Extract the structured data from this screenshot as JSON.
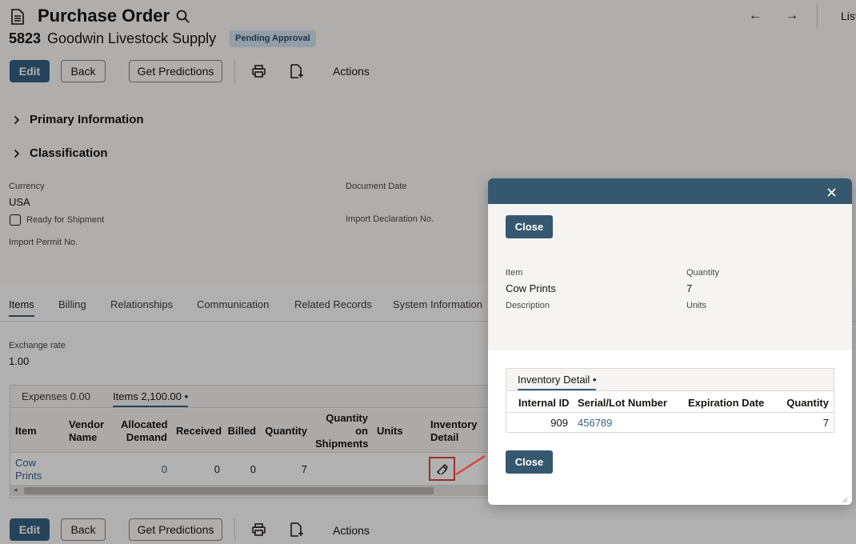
{
  "header": {
    "title": "Purchase Order",
    "record_number": "5823",
    "vendor": "Goodwin Livestock Supply",
    "status": "Pending Approval",
    "list_label": "List"
  },
  "toolbar": {
    "edit": "Edit",
    "back": "Back",
    "get_predictions": "Get Predictions",
    "actions": "Actions"
  },
  "sections": {
    "primary": "Primary Information",
    "classification": "Classification"
  },
  "fields": {
    "currency_label": "Currency",
    "currency_value": "USA",
    "ready_for_shipment": "Ready for Shipment",
    "import_permit_label": "Import Permit No.",
    "document_date_label": "Document Date",
    "import_declaration_label": "Import Declaration No."
  },
  "tabs": [
    "Items",
    "Billing",
    "Relationships",
    "Communication",
    "Related Records",
    "System Information"
  ],
  "exchange": {
    "label": "Exchange rate",
    "value": "1.00"
  },
  "subtabs": {
    "expenses": "Expenses 0.00",
    "items": "Items 2,100.00 •"
  },
  "items_table": {
    "headers": {
      "item": "Item",
      "vendor_name": "Vendor Name",
      "allocated_demand": "Allocated Demand",
      "received": "Received",
      "billed": "Billed",
      "quantity": "Quantity",
      "quantity_on_shipments": "Quantity on Shipments",
      "units": "Units",
      "inventory_detail": "Inventory Detail"
    },
    "row": {
      "item": "Cow Prints",
      "allocated_demand": "0",
      "received": "0",
      "billed": "0",
      "quantity": "7"
    }
  },
  "modal": {
    "close_label": "Close",
    "item_label": "Item",
    "item_value": "Cow Prints",
    "description_label": "Description",
    "quantity_label": "Quantity",
    "quantity_value": "7",
    "units_label": "Units",
    "inventory_tab": "Inventory Detail •",
    "table": {
      "headers": {
        "internal_id": "Internal ID",
        "serial_lot": "Serial/Lot Number",
        "expiration": "Expiration Date",
        "quantity": "Quantity"
      },
      "row": {
        "internal_id": "909",
        "serial_lot": "456789",
        "quantity": "7"
      }
    }
  },
  "colors": {
    "primary_button": "#356182",
    "modal_header": "#36586f",
    "link": "#356182",
    "highlight": "#e0443a"
  },
  "icons": [
    "document-icon",
    "search-icon",
    "arrow-left-icon",
    "arrow-right-icon",
    "print-icon",
    "document-add-icon",
    "chevron-right-icon",
    "inventory-detail-icon",
    "close-icon"
  ]
}
